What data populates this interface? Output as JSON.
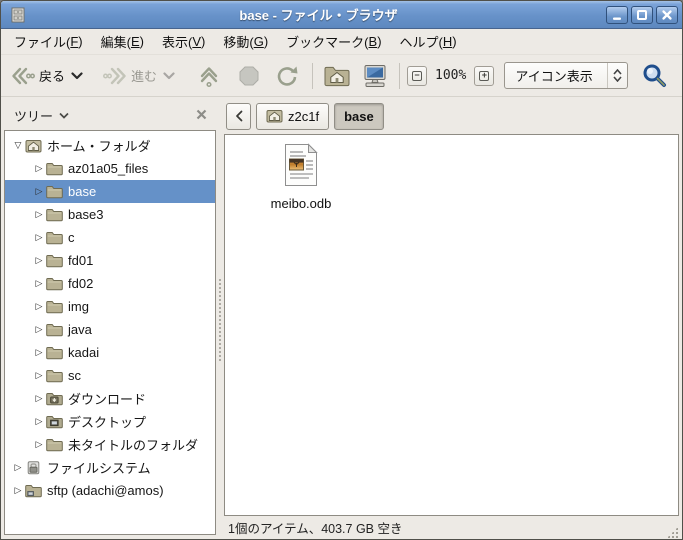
{
  "window": {
    "title": "base - ファイル・ブラウザ"
  },
  "titlebar": {
    "icon": "file-manager-icon",
    "controls": [
      {
        "name": "minimize-button",
        "icon": "minimize-icon"
      },
      {
        "name": "maximize-button",
        "icon": "maximize-icon"
      },
      {
        "name": "close-button",
        "icon": "close-icon"
      }
    ]
  },
  "menubar": {
    "items": [
      {
        "label": "ファイル(F)"
      },
      {
        "label": "編集(E)"
      },
      {
        "label": "表示(V)"
      },
      {
        "label": "移動(G)"
      },
      {
        "label": "ブックマーク(B)"
      },
      {
        "label": "ヘルプ(H)"
      }
    ]
  },
  "toolbar": {
    "back_label": "戻る",
    "forward_label": "進む",
    "zoom_level": "100%",
    "view_mode": "アイコン表示"
  },
  "sidebar": {
    "mode_label": "ツリー",
    "tree": [
      {
        "label": "ホーム・フォルダ",
        "level": 0,
        "expander": "expanded",
        "icon": "home-folder-icon",
        "selected": false
      },
      {
        "label": "az01a05_files",
        "level": 1,
        "expander": "collapsed",
        "icon": "folder-icon",
        "selected": false
      },
      {
        "label": "base",
        "level": 1,
        "expander": "collapsed",
        "icon": "folder-icon",
        "selected": true
      },
      {
        "label": "base3",
        "level": 1,
        "expander": "collapsed",
        "icon": "folder-icon",
        "selected": false
      },
      {
        "label": "c",
        "level": 1,
        "expander": "collapsed",
        "icon": "folder-icon",
        "selected": false
      },
      {
        "label": "fd01",
        "level": 1,
        "expander": "collapsed",
        "icon": "folder-icon",
        "selected": false
      },
      {
        "label": "fd02",
        "level": 1,
        "expander": "collapsed",
        "icon": "folder-icon",
        "selected": false
      },
      {
        "label": "img",
        "level": 1,
        "expander": "collapsed",
        "icon": "folder-icon",
        "selected": false
      },
      {
        "label": "java",
        "level": 1,
        "expander": "collapsed",
        "icon": "folder-icon",
        "selected": false
      },
      {
        "label": "kadai",
        "level": 1,
        "expander": "collapsed",
        "icon": "folder-icon",
        "selected": false
      },
      {
        "label": "sc",
        "level": 1,
        "expander": "collapsed",
        "icon": "folder-icon",
        "selected": false
      },
      {
        "label": "ダウンロード",
        "level": 1,
        "expander": "collapsed",
        "icon": "download-folder-icon",
        "selected": false
      },
      {
        "label": "デスクトップ",
        "level": 1,
        "expander": "collapsed",
        "icon": "desktop-folder-icon",
        "selected": false
      },
      {
        "label": "未タイトルのフォルダ",
        "level": 1,
        "expander": "collapsed",
        "icon": "folder-icon",
        "selected": false
      },
      {
        "label": "ファイルシステム",
        "level": 0,
        "expander": "collapsed",
        "icon": "filesystem-icon",
        "selected": false
      },
      {
        "label": "sftp (adachi@amos)",
        "level": 0,
        "expander": "collapsed",
        "icon": "network-folder-icon",
        "selected": false
      }
    ]
  },
  "pathbar": {
    "back_icon": "path-back-icon",
    "buttons": [
      {
        "label": "z2c1f",
        "icon": "home-folder-icon",
        "active": false
      },
      {
        "label": "base",
        "icon": null,
        "active": true
      }
    ]
  },
  "content": {
    "files": [
      {
        "name": "meibo.odb",
        "icon": "odb-file-icon"
      }
    ]
  },
  "statusbar": {
    "text": "1個のアイテム、403.7 GB 空き"
  },
  "colors": {
    "titlebar": "#6792c9",
    "selection": "#6591c8",
    "window-bg": "#edeae5",
    "folder": "#b9b294",
    "search-blue": "#1f4e8c"
  }
}
